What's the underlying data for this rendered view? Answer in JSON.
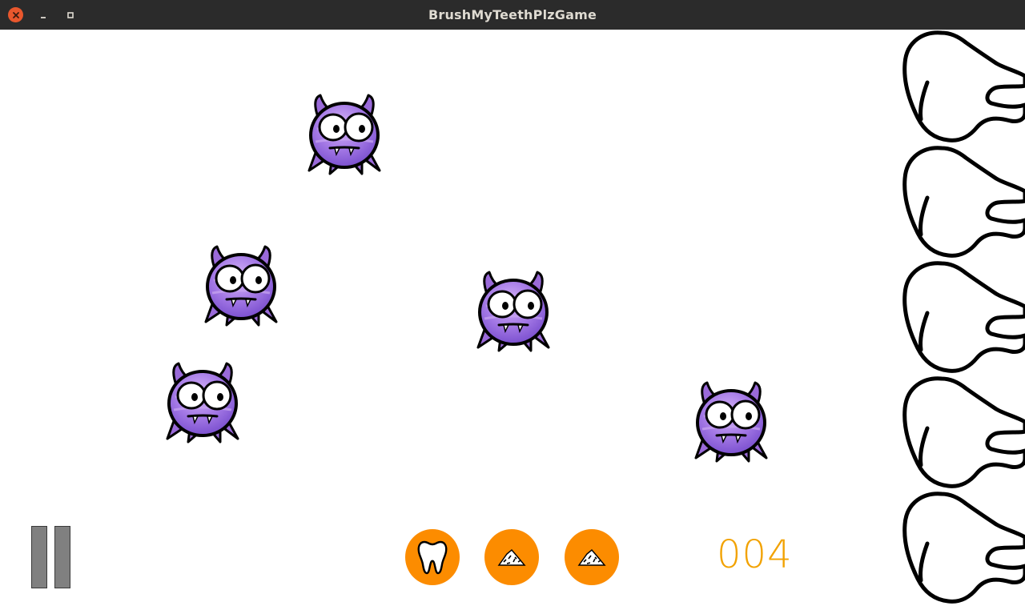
{
  "window": {
    "title": "BrushMyTeethPlzGame"
  },
  "game": {
    "monster_count": 5,
    "tooth_count": 5,
    "score": "004",
    "powerups": [
      {
        "icon": "tooth-icon"
      },
      {
        "icon": "plaque-pile-icon"
      },
      {
        "icon": "plaque-pile-icon"
      }
    ],
    "colors": {
      "powerup_bg": "#fc8c00",
      "score": "#f2a200",
      "monster_body": "#9b6fe0",
      "pause_bar": "#808080"
    }
  }
}
